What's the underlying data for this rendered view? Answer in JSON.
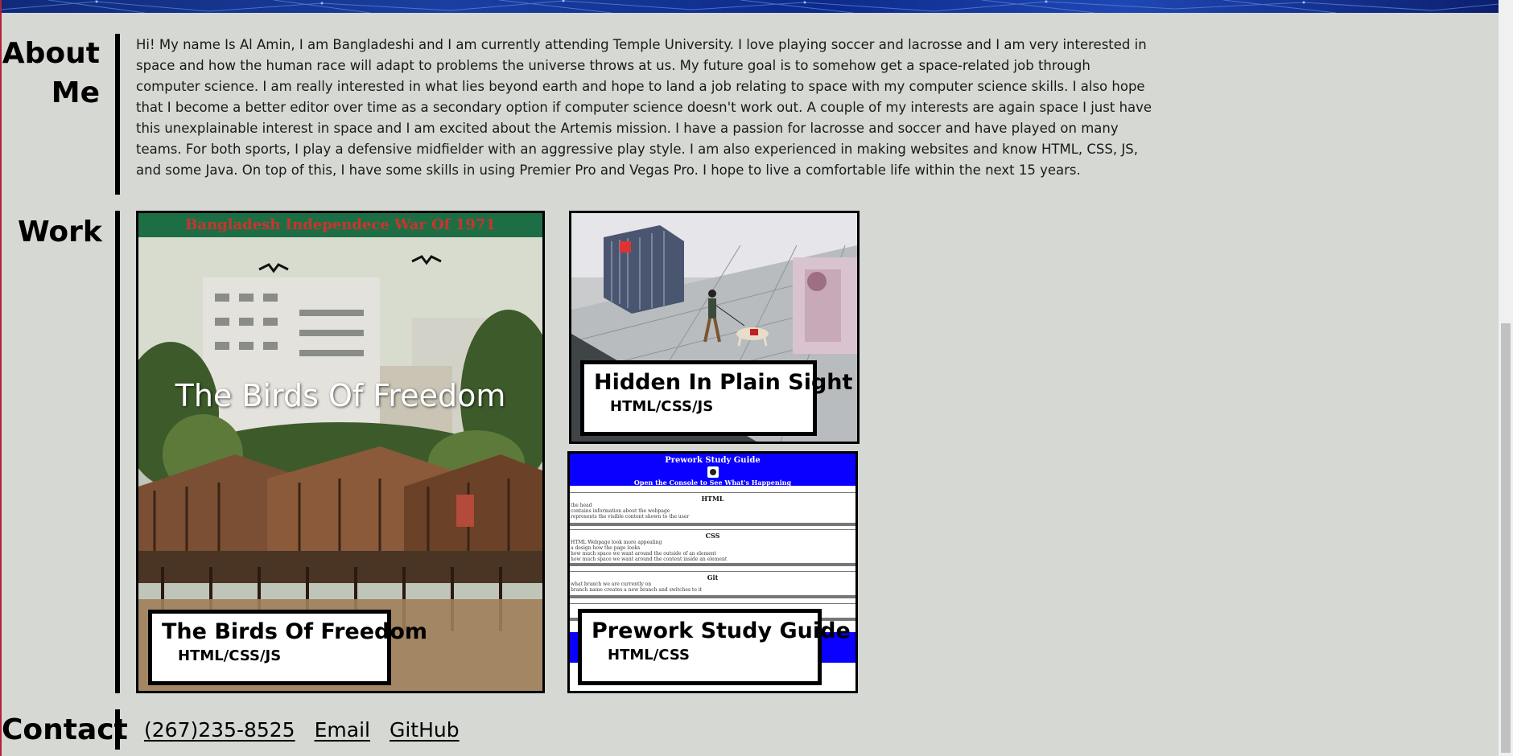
{
  "about": {
    "heading_line1": "About",
    "heading_line2": "Me",
    "text": "Hi! My name Is Al Amin, I am Bangladeshi and I am currently attending Temple University. I love playing soccer and lacrosse and I am very interested in space and how the human race will adapt to problems the universe throws at us. My future goal is to somehow get a space-related job through computer science. I am really interested in what lies beyond earth and hope to land a job relating to space with my computer science skills. I also hope that I become a better editor over time as a secondary option if computer science doesn't work out. A couple of my interests are again space I just have this unexplainable interest in space and I am excited about the Artemis mission. I have a passion for lacrosse and soccer and have played on many teams. For both sports, I play a defensive midfielder with an aggressive play style. I am also experienced in making websites and know HTML, CSS, JS, and some Java. On top of this, I have some skills in using Premier Pro and Vegas Pro. I hope to live a comfortable life within the next 15 years."
  },
  "work": {
    "heading": "Work",
    "projects": [
      {
        "title": "The Birds Of Freedom",
        "tech": "HTML/CSS/JS",
        "image_top_title": "Bangladesh Independece War Of 1971",
        "image_overlay_title": "The Birds Of Freedom"
      },
      {
        "title": "Hidden In Plain Sight",
        "tech": "HTML/CSS/JS"
      },
      {
        "title": "Prework Study Guide",
        "tech": "HTML/CSS",
        "preview": {
          "header_title": "Prework Study Guide",
          "header_sub": "Open the Console to See What's Happening",
          "sections": [
            {
              "name": "HTML",
              "lines": [
                "the head",
                "contains information about the webpage",
                "represents the visible content shown to the user"
              ]
            },
            {
              "name": "CSS",
              "lines": [
                "HTML Webpage look more appealing",
                "a design how the page looks",
                "how much space we want around the outside of an element",
                "how much space we want around the content inside an element"
              ]
            },
            {
              "name": "Git",
              "lines": [
                "what branch we are currently on",
                "branch name creates a new branch and switches to it"
              ]
            }
          ]
        }
      }
    ]
  },
  "contact": {
    "heading": "Contact",
    "phone": "(267)235-8525",
    "email": "Email",
    "github": "GitHub"
  },
  "colors": {
    "background": "#d6d8d3",
    "banner": "#1a3fa0",
    "prework_blue": "#0a00ff",
    "birds_title_green": "#1e6e45",
    "birds_title_red": "#c8352c"
  }
}
